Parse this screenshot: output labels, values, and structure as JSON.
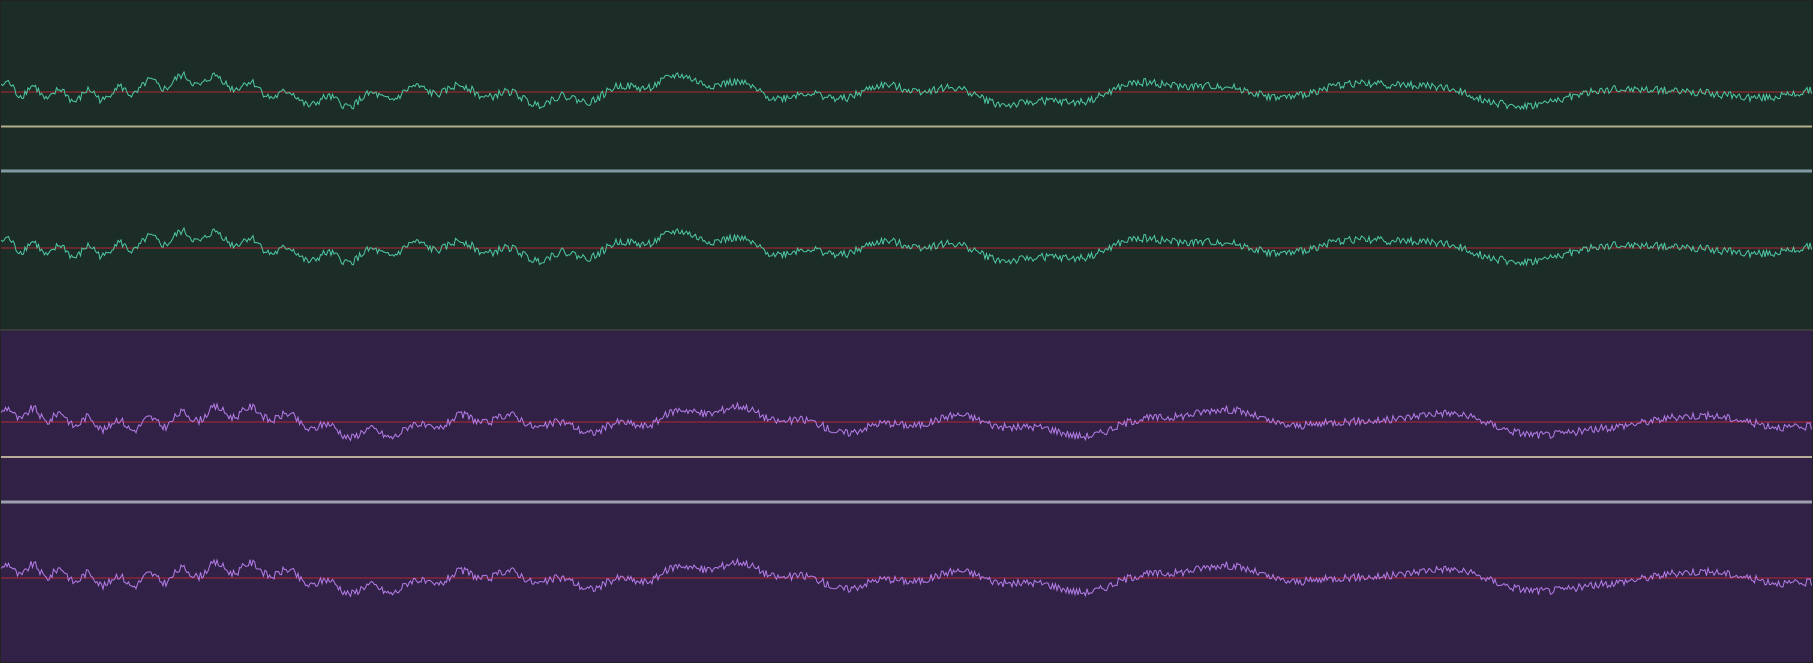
{
  "editor": {
    "background": "#232323",
    "divider_color": "#3b3b3b"
  },
  "clips": [
    {
      "id": "clip-a",
      "background": "#1c2d28",
      "waveform_color": "#4fc9a4",
      "center_line_color": "#b0262f",
      "channels": 2,
      "separator_colors": [
        "#b5ad8a",
        "#7f9aa2"
      ]
    },
    {
      "id": "clip-b",
      "background": "#322147",
      "waveform_color": "#b47de8",
      "center_line_color": "#b0262f",
      "channels": 2,
      "separator_colors": [
        "#b8ab97",
        "#9c9fac"
      ]
    }
  ],
  "waveform": {
    "shape": "noise",
    "relative_amplitude": 0.42
  }
}
